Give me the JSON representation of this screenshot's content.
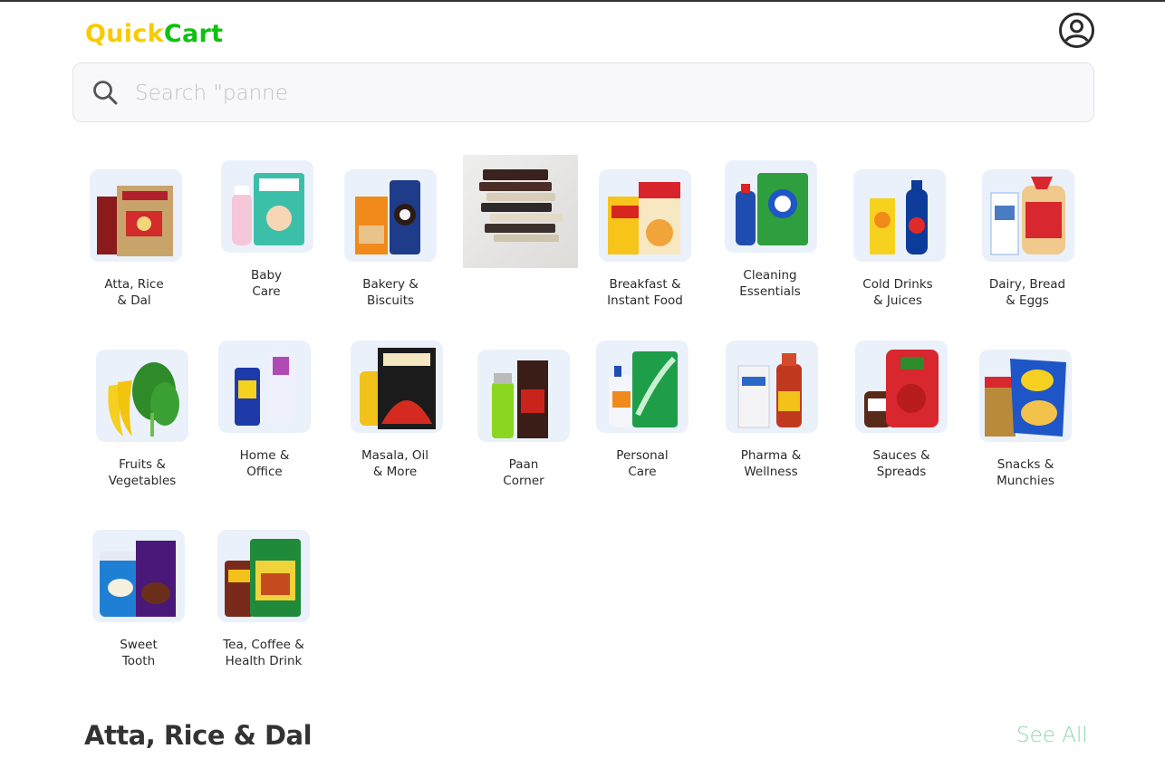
{
  "header": {
    "logo_part1": "Quick",
    "logo_part2": "Cart",
    "colors": {
      "logo_part1": "#f8cb00",
      "logo_part2": "#0fc10f"
    },
    "profile_icon": "user-circle-icon"
  },
  "search": {
    "icon": "search-icon",
    "placeholder": "Search \"panne"
  },
  "categories": [
    {
      "line1": "Atta, Rice",
      "line2": "& Dal"
    },
    {
      "line1": "Baby",
      "line2": "Care"
    },
    {
      "line1": "Bakery &",
      "line2": "Biscuits"
    },
    {
      "line1": "",
      "line2": ""
    },
    {
      "line1": "Breakfast &",
      "line2": "Instant Food"
    },
    {
      "line1": "Cleaning",
      "line2": "Essentials"
    },
    {
      "line1": "Cold Drinks",
      "line2": "& Juices"
    },
    {
      "line1": "Dairy, Bread",
      "line2": "& Eggs"
    },
    {
      "line1": "Fruits &",
      "line2": "Vegetables"
    },
    {
      "line1": "Home &",
      "line2": "Office"
    },
    {
      "line1": "Masala, Oil",
      "line2": "& More"
    },
    {
      "line1": "Paan",
      "line2": "Corner"
    },
    {
      "line1": "Personal",
      "line2": "Care"
    },
    {
      "line1": "Pharma &",
      "line2": "Wellness"
    },
    {
      "line1": "Sauces &",
      "line2": "Spreads"
    },
    {
      "line1": "Snacks &",
      "line2": "Munchies"
    },
    {
      "line1": "Sweet",
      "line2": "Tooth"
    },
    {
      "line1": "Tea, Coffee &",
      "line2": "Health Drink"
    }
  ],
  "section": {
    "title": "Atta, Rice & Dal",
    "see_all": "See All",
    "see_all_color": "#8fd6a9"
  }
}
